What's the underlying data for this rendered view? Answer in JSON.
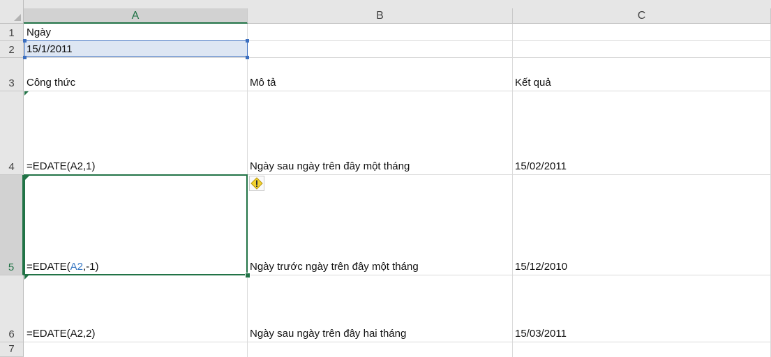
{
  "columns": [
    "A",
    "B",
    "C"
  ],
  "rows": [
    "1",
    "2",
    "3",
    "4",
    "5",
    "6",
    "7"
  ],
  "active_column": "A",
  "active_row": "5",
  "cells": {
    "A1": "Ngày",
    "A2": "15/1/2011",
    "A3": "Công thức",
    "B3": "Mô tả",
    "C3": "Kết quả",
    "A4": "=EDATE(A2,1)",
    "B4": "Ngày sau ngày trên đây một tháng",
    "C4": "15/02/2011",
    "A5": {
      "prefix": "=EDATE(",
      "ref": "A2",
      "suffix": ",-1)"
    },
    "B5": "Ngày trước ngày trên đây một tháng",
    "C5": "15/12/2010",
    "A6": "=EDATE(A2,2)",
    "B6": "Ngày sau ngày trên đây hai tháng",
    "C6": "15/03/2011"
  },
  "warning_icon": "exclamation-diamond-icon",
  "colors": {
    "active_green": "#217346",
    "ref_blue": "#3a78c2",
    "warning_yellow": "#f3d230"
  }
}
